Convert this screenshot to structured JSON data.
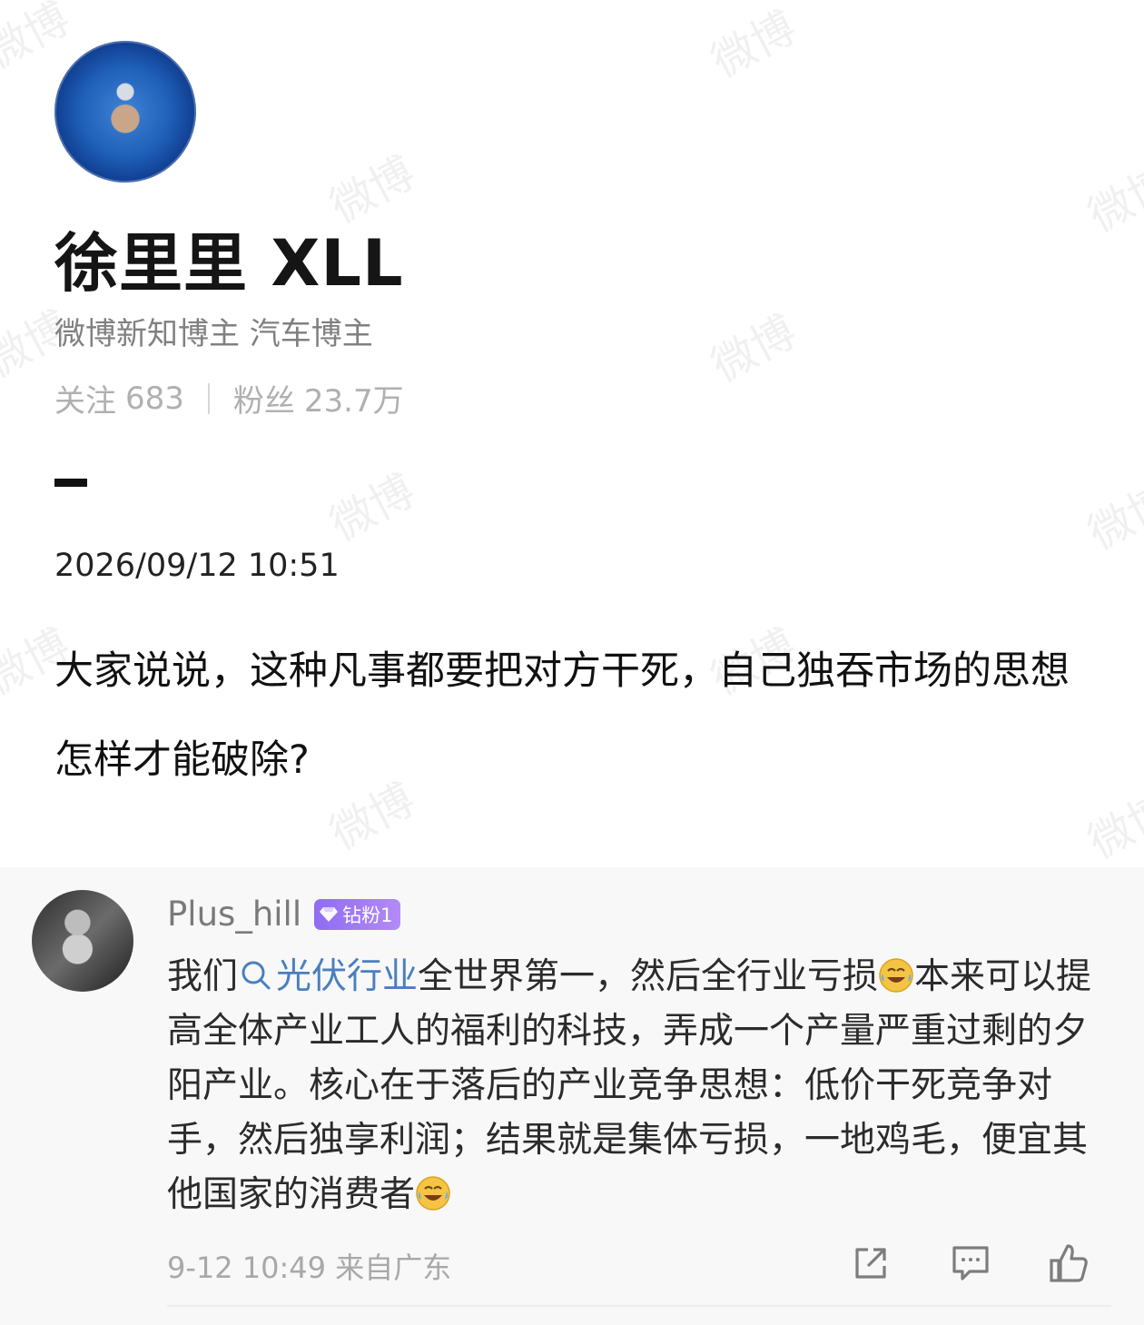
{
  "watermark_text": "微博",
  "profile": {
    "name": "徐里里 XLL",
    "tags": "微博新知博主 汽车博主",
    "following_label": "关注",
    "following_count": "683",
    "followers_label": "粉丝",
    "followers_count": "23.7万"
  },
  "post": {
    "datetime": "2026/09/12 10:51",
    "text": "大家说说，这种凡事都要把对方干死，自己独吞市场的思想怎样才能破除?"
  },
  "comment": {
    "username": "Plus_hill",
    "badge": "钻粉1",
    "text_part1": "我们",
    "topic_link": "光伏行业",
    "text_part2": "全世界第一，然后全行业亏损",
    "text_part3": "本来可以提高全体产业工人的福利的科技，弄成一个产量严重过剩的夕阳产业。核心在于落后的产业竞争思想：低价干死竞争对手，然后独享利润；结果就是集体亏损，一地鸡毛，便宜其他国家的消费者",
    "meta": "9-12 10:49 来自广东"
  },
  "colors": {
    "link": "#4a7fbf",
    "badge": "#9a76f5",
    "muted": "#a8a8a8"
  },
  "icons": [
    "search-icon",
    "laugh-cry-emoji",
    "share-icon",
    "comment-icon",
    "like-icon",
    "gem-icon"
  ]
}
